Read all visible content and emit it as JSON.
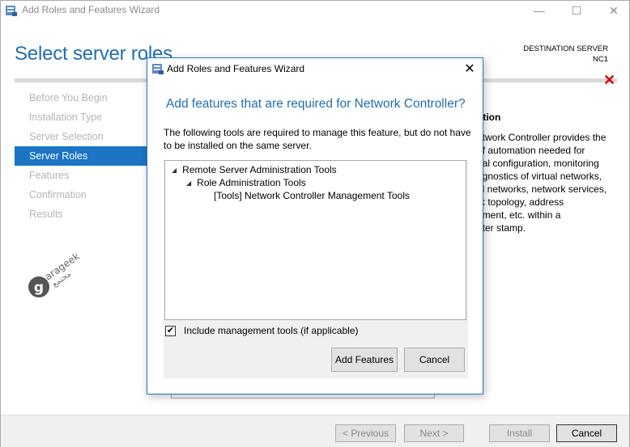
{
  "window": {
    "title": "Add Roles and Features Wizard",
    "minimize_glyph": "—",
    "maximize_glyph": "☐",
    "close_glyph": "✕"
  },
  "page": {
    "title": "Select server roles",
    "destination_label": "DESTINATION SERVER",
    "destination_name": "NC1",
    "error_icon_glyph": "✕"
  },
  "nav": {
    "items": [
      {
        "label": "Before You Begin"
      },
      {
        "label": "Installation Type"
      },
      {
        "label": "Server Selection"
      },
      {
        "label": "Server Roles"
      },
      {
        "label": "Features"
      },
      {
        "label": "Confirmation"
      },
      {
        "label": "Results"
      }
    ],
    "active_index": 3
  },
  "watermark": {
    "latin": "arageek",
    "arabic": "مجتمع",
    "glyph": "g"
  },
  "description": {
    "heading": "ption",
    "lines": [
      "etwork Controller provides the",
      "of automation needed for",
      "ual configuration, monitoring",
      "agnostics of virtual networks,",
      "al networks, network services,",
      "rk topology, address",
      "ement, etc. within a",
      "nter stamp."
    ]
  },
  "footer": {
    "previous": "< Previous",
    "next": "Next >",
    "install": "Install",
    "cancel": "Cancel"
  },
  "modal": {
    "title": "Add Roles and Features Wizard",
    "close_glyph": "✕",
    "heading": "Add features that are required for Network Controller?",
    "text": "The following tools are required to manage this feature, but do not have to be installed on the same server.",
    "tree": [
      {
        "label": "Remote Server Administration Tools",
        "expander": "◢"
      },
      {
        "label": "Role Administration Tools",
        "expander": "◢"
      },
      {
        "label": "[Tools] Network Controller Management Tools",
        "expander": ""
      }
    ],
    "include_tools_label": "Include management tools (if applicable)",
    "include_tools_checked": true,
    "check_glyph": "✔",
    "add_features": "Add Features",
    "cancel": "Cancel"
  },
  "colors": {
    "accent": "#1f6fb0",
    "nav_active": "#1c74c4",
    "error": "#d9000a"
  }
}
